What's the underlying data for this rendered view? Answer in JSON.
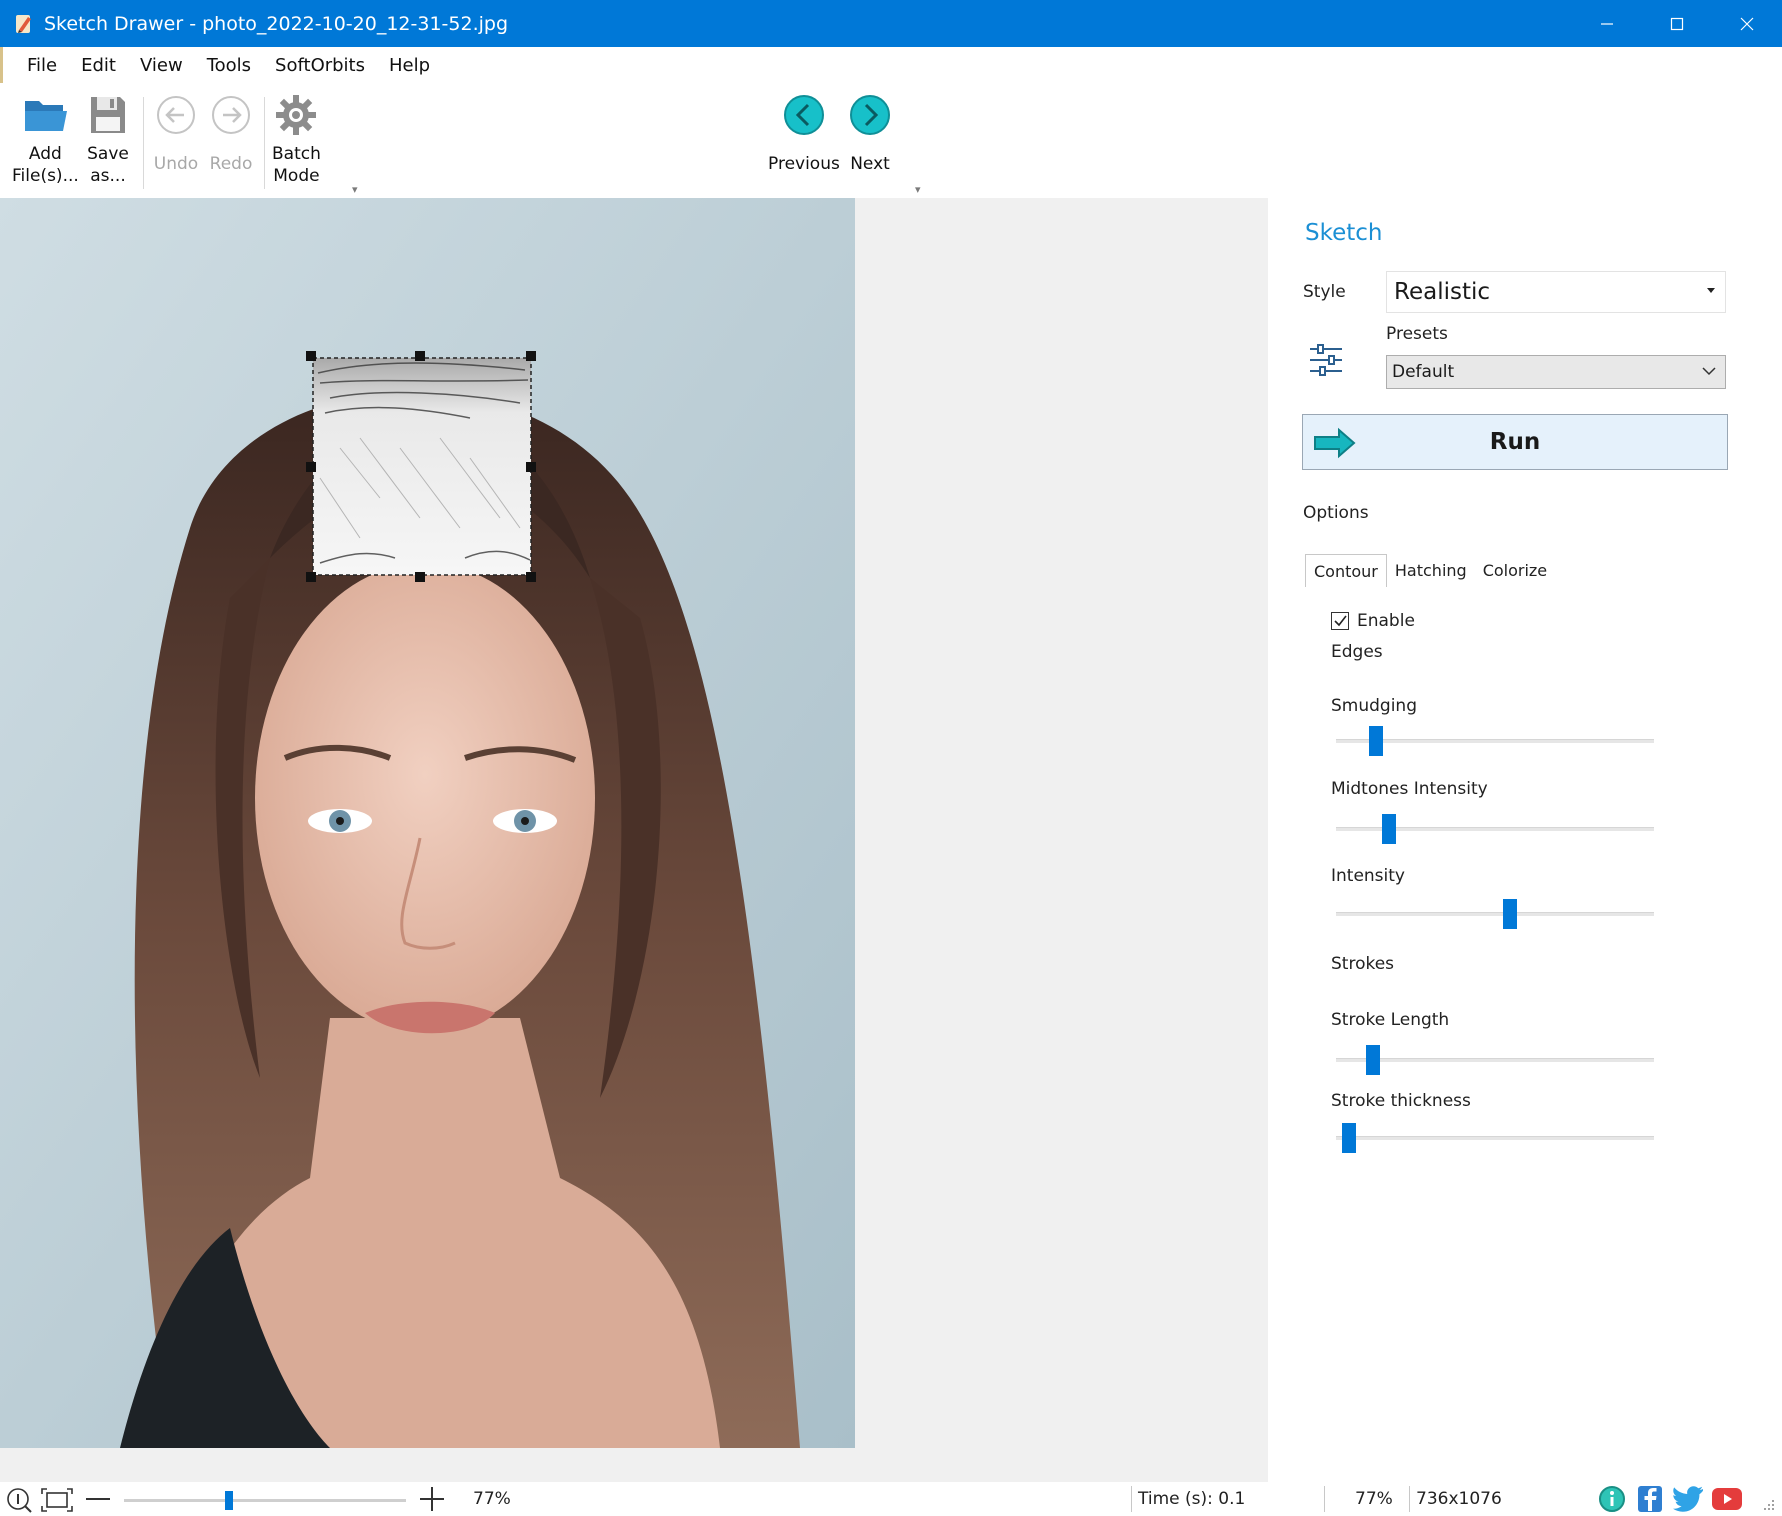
{
  "window": {
    "title": "Sketch Drawer - photo_2022-10-20_12-31-52.jpg",
    "controls": [
      "minimize-icon",
      "maximize-icon",
      "close-icon"
    ]
  },
  "menu": [
    "File",
    "Edit",
    "View",
    "Tools",
    "SoftOrbits",
    "Help"
  ],
  "toolbar": {
    "add_files": "Add\nFile(s)...",
    "save_as": "Save\nas...",
    "undo": "Undo",
    "redo": "Redo",
    "batch_mode": "Batch\nMode",
    "previous": "Previous",
    "next": "Next"
  },
  "panel": {
    "title": "Sketch",
    "style_label": "Style",
    "style_value": "Realistic",
    "presets_label": "Presets",
    "presets_value": "Default",
    "run_label": "Run",
    "options_label": "Options",
    "tabs": [
      "Contour",
      "Hatching",
      "Colorize"
    ],
    "active_tab": "Contour",
    "enable_label": "Enable",
    "enable_checked": true,
    "edges_label": "Edges",
    "strokes_label": "Strokes",
    "sliders": [
      {
        "label": "Smudging",
        "value": 0.11
      },
      {
        "label": "Midtones Intensity",
        "value": 0.15
      },
      {
        "label": "Intensity",
        "value": 0.55
      },
      {
        "label": "Stroke Length",
        "value": 0.1
      },
      {
        "label": "Stroke thickness",
        "value": 0.02
      }
    ]
  },
  "status": {
    "zoom_text": "77%",
    "zoom_slider_value": 0.37,
    "time": "Time (s): 0.1",
    "zoom_readout": "77%",
    "dimensions": "736x1076",
    "social_icons": [
      "info-icon",
      "facebook-icon",
      "twitter-icon",
      "youtube-icon"
    ]
  },
  "colors": {
    "titlebar": "#0078d7",
    "accent": "#1b8fd4",
    "slider_thumb": "#0078d7",
    "nav_circle": "#17c0c9"
  }
}
